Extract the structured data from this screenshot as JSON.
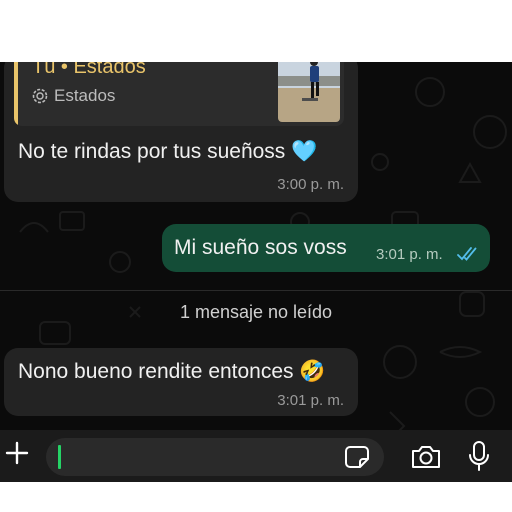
{
  "messages": {
    "incoming_1": {
      "quote": {
        "author": "Tú • Estados",
        "subtitle": "Estados"
      },
      "text": "No te rindas por tus sueñoss 🩵",
      "time": "3:00 p. m."
    },
    "outgoing_1": {
      "text": "Mi sueño sos voss",
      "time": "3:01 p. m.",
      "status": "read-double-check",
      "status_color": "#53bdeb"
    },
    "unread_divider": "1 mensaje no leído",
    "incoming_2": {
      "text": "Nono bueno rendite entonces 🤣",
      "time": "3:01 p. m."
    }
  },
  "composer": {
    "value": "",
    "icons": [
      "plus-icon",
      "sticker-icon",
      "camera-icon",
      "mic-icon"
    ]
  },
  "colors": {
    "incoming_bubble": "#232323",
    "outgoing_bubble": "#144d37",
    "quote_accent": "#e9c46a",
    "caret": "#25d366"
  }
}
